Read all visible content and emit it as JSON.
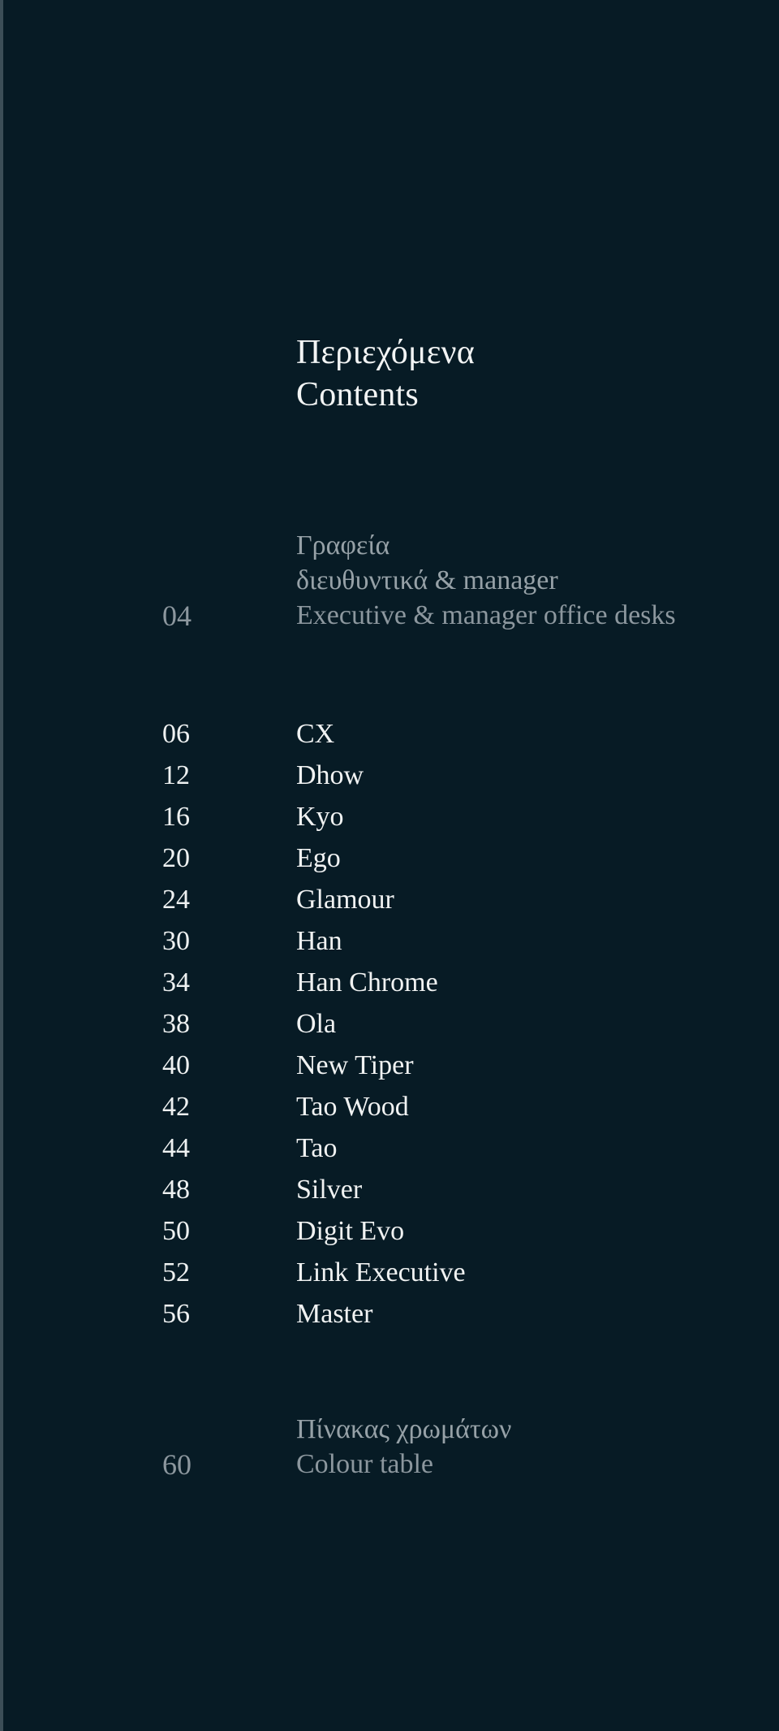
{
  "page": {
    "background_color": "#071b25",
    "heading_color": "#f2f4f4",
    "section_color": "#96a1a7",
    "entry_color": "#f0f2f2",
    "spine_color": "#3c4e57"
  },
  "title": {
    "greek": "Περιεχόμενα",
    "english": "Contents"
  },
  "sections": [
    {
      "number": "04",
      "greek_line1": "Γραφεία",
      "greek_line2": "διευθυντικά & manager",
      "english": "Executive & manager office desks",
      "entries": [
        {
          "page": "06",
          "label": "CX"
        },
        {
          "page": "12",
          "label": "Dhow"
        },
        {
          "page": "16",
          "label": "Kyo"
        },
        {
          "page": "20",
          "label": "Ego"
        },
        {
          "page": "24",
          "label": "Glamour"
        },
        {
          "page": "30",
          "label": "Han"
        },
        {
          "page": "34",
          "label": "Han Chrome"
        },
        {
          "page": "38",
          "label": "Ola"
        },
        {
          "page": "40",
          "label": "New Tiper"
        },
        {
          "page": "42",
          "label": "Tao Wood"
        },
        {
          "page": "44",
          "label": "Tao"
        },
        {
          "page": "48",
          "label": "Silver"
        },
        {
          "page": "50",
          "label": "Digit Evo"
        },
        {
          "page": "52",
          "label": "Link Executive"
        },
        {
          "page": "56",
          "label": "Master"
        }
      ]
    },
    {
      "number": "60",
      "greek_line1": "Πίνακας χρωμάτων",
      "english": "Colour table",
      "entries": []
    }
  ]
}
